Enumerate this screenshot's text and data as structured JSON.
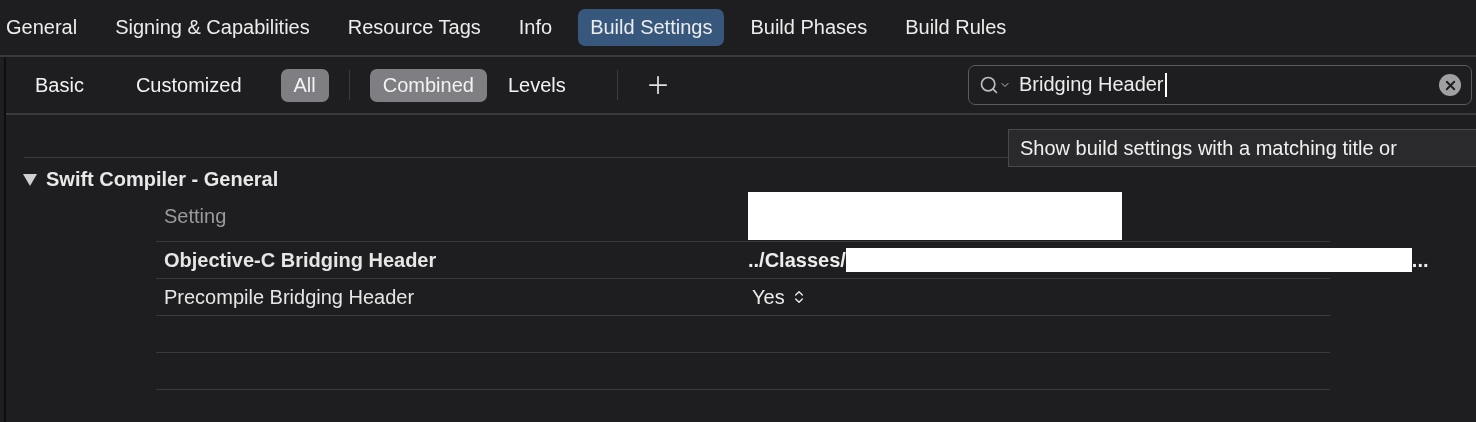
{
  "tabs": [
    {
      "label": "General",
      "selected": false
    },
    {
      "label": "Signing & Capabilities",
      "selected": false
    },
    {
      "label": "Resource Tags",
      "selected": false
    },
    {
      "label": "Info",
      "selected": false
    },
    {
      "label": "Build Settings",
      "selected": true
    },
    {
      "label": "Build Phases",
      "selected": false
    },
    {
      "label": "Build Rules",
      "selected": false
    }
  ],
  "filter_bar": {
    "scope": [
      {
        "label": "Basic",
        "selected": false
      },
      {
        "label": "Customized",
        "selected": false
      },
      {
        "label": "All",
        "selected": true
      }
    ],
    "view": [
      {
        "label": "Combined",
        "selected": true
      },
      {
        "label": "Levels",
        "selected": false
      }
    ]
  },
  "search": {
    "value": "Bridging Header"
  },
  "tooltip": "Show build settings with a matching title or",
  "section": {
    "title": "Swift Compiler - General",
    "expanded": true,
    "header": "Setting",
    "rows": [
      {
        "kind": "path",
        "name": "Objective-C Bridging Header",
        "value": "../Classes/",
        "suffix": "...",
        "bold": true
      },
      {
        "kind": "popup",
        "name": "Precompile Bridging Header",
        "value": "Yes",
        "bold": false
      }
    ]
  }
}
